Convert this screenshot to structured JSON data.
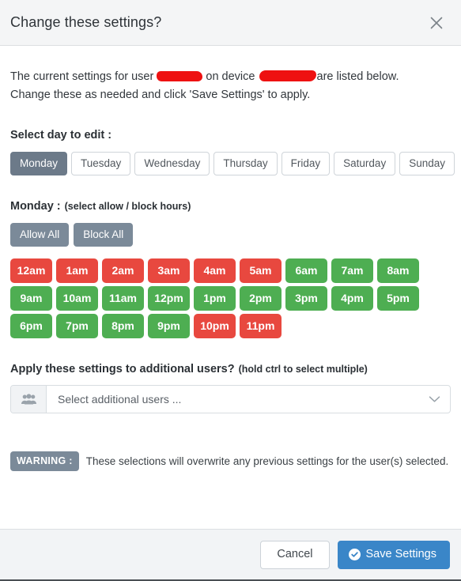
{
  "header": {
    "title": "Change these settings?",
    "close_icon": "close-icon"
  },
  "intro": {
    "line1_part1": "The current settings for user",
    "line1_part2": "on device",
    "line1_part3": "are listed below.",
    "line2": "Change these as needed and click 'Save Settings' to apply.",
    "user_redacted": "",
    "device_redacted": ""
  },
  "day_selector": {
    "label": "Select day to edit :",
    "selected": "Monday",
    "days": [
      {
        "label": "Monday",
        "active": true
      },
      {
        "label": "Tuesday",
        "active": false
      },
      {
        "label": "Wednesday",
        "active": false
      },
      {
        "label": "Thursday",
        "active": false
      },
      {
        "label": "Friday",
        "active": false
      },
      {
        "label": "Saturday",
        "active": false
      },
      {
        "label": "Sunday",
        "active": false
      }
    ]
  },
  "hours_section": {
    "day_label": "Monday :",
    "hint": "(select allow / block hours)",
    "allow_all_label": "Allow All",
    "block_all_label": "Block All",
    "allow_color": "#4eae52",
    "block_color": "#e8483f",
    "hours": [
      {
        "label": "12am",
        "state": "block"
      },
      {
        "label": "1am",
        "state": "block"
      },
      {
        "label": "2am",
        "state": "block"
      },
      {
        "label": "3am",
        "state": "block"
      },
      {
        "label": "4am",
        "state": "block"
      },
      {
        "label": "5am",
        "state": "block"
      },
      {
        "label": "6am",
        "state": "allow"
      },
      {
        "label": "7am",
        "state": "allow"
      },
      {
        "label": "8am",
        "state": "allow"
      },
      {
        "label": "9am",
        "state": "allow"
      },
      {
        "label": "10am",
        "state": "allow"
      },
      {
        "label": "11am",
        "state": "allow"
      },
      {
        "label": "12pm",
        "state": "allow"
      },
      {
        "label": "1pm",
        "state": "allow"
      },
      {
        "label": "2pm",
        "state": "allow"
      },
      {
        "label": "3pm",
        "state": "allow"
      },
      {
        "label": "4pm",
        "state": "allow"
      },
      {
        "label": "5pm",
        "state": "allow"
      },
      {
        "label": "6pm",
        "state": "allow"
      },
      {
        "label": "7pm",
        "state": "allow"
      },
      {
        "label": "8pm",
        "state": "allow"
      },
      {
        "label": "9pm",
        "state": "allow"
      },
      {
        "label": "10pm",
        "state": "block"
      },
      {
        "label": "11pm",
        "state": "block"
      }
    ]
  },
  "additional_users": {
    "label": "Apply these settings to additional users?",
    "hint": "(hold ctrl to select multiple)",
    "icon": "users-icon",
    "placeholder": "Select additional users ...",
    "value": "Select additional users ...",
    "chevron": "chevron-down-icon"
  },
  "warning": {
    "badge": "WARNING :",
    "text": "These selections will overwrite any previous settings for the user(s) selected.",
    "badge_color": "#7b8a99"
  },
  "footer": {
    "cancel_label": "Cancel",
    "save_label": "Save Settings",
    "save_icon": "check-circle-icon",
    "save_color": "#3a86c8"
  }
}
